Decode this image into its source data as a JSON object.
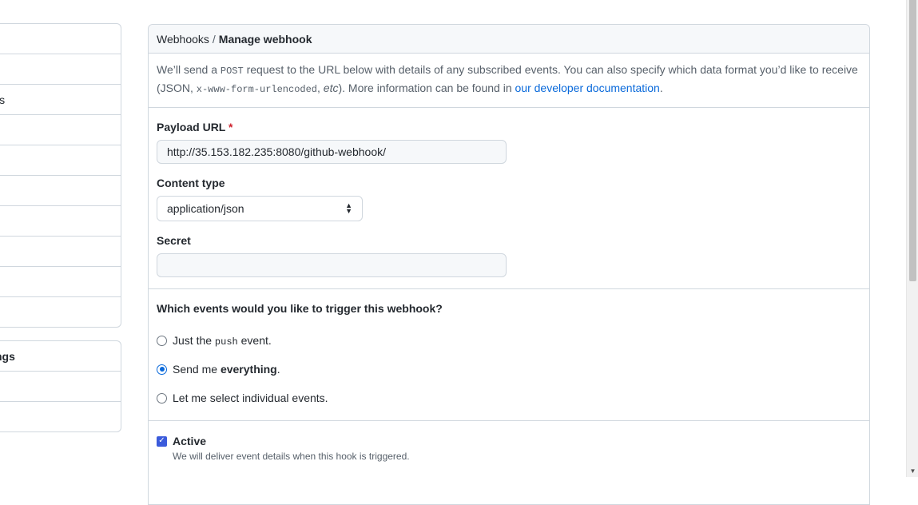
{
  "sidebar": {
    "group1": [
      "",
      "",
      "is",
      "",
      "",
      "",
      "",
      "",
      "",
      ""
    ],
    "group2_header": "ngs",
    "group2": [
      "",
      ""
    ]
  },
  "breadcrumb": {
    "parent": "Webhooks",
    "separator": "/",
    "current": "Manage webhook"
  },
  "intro": {
    "part1": "We’ll send a ",
    "code1": "POST",
    "part2": " request to the URL below with details of any subscribed events. You can also specify which data format you’d like to receive (JSON, ",
    "code2": "x-www-form-urlencoded",
    "part3": ", ",
    "etc": "etc",
    "part4": "). More information can be found in ",
    "link": "our developer documentation",
    "part5": "."
  },
  "form": {
    "payload_label": "Payload URL",
    "required_mark": "*",
    "payload_value": "http://35.153.182.235:8080/github-webhook/",
    "content_type_label": "Content type",
    "content_type_value": "application/json",
    "secret_label": "Secret",
    "secret_value": ""
  },
  "events": {
    "question": "Which events would you like to trigger this webhook?",
    "opt1_pre": "Just the ",
    "opt1_code": "push",
    "opt1_post": " event.",
    "opt2_pre": "Send me ",
    "opt2_bold": "everything",
    "opt2_post": ".",
    "opt3": "Let me select individual events.",
    "selected": "everything"
  },
  "active": {
    "label": "Active",
    "checked": true,
    "note": "We will deliver event details when this hook is triggered."
  },
  "colors": {
    "link": "#0969da",
    "accent": "#3b5bdb",
    "required": "#cf222e"
  }
}
